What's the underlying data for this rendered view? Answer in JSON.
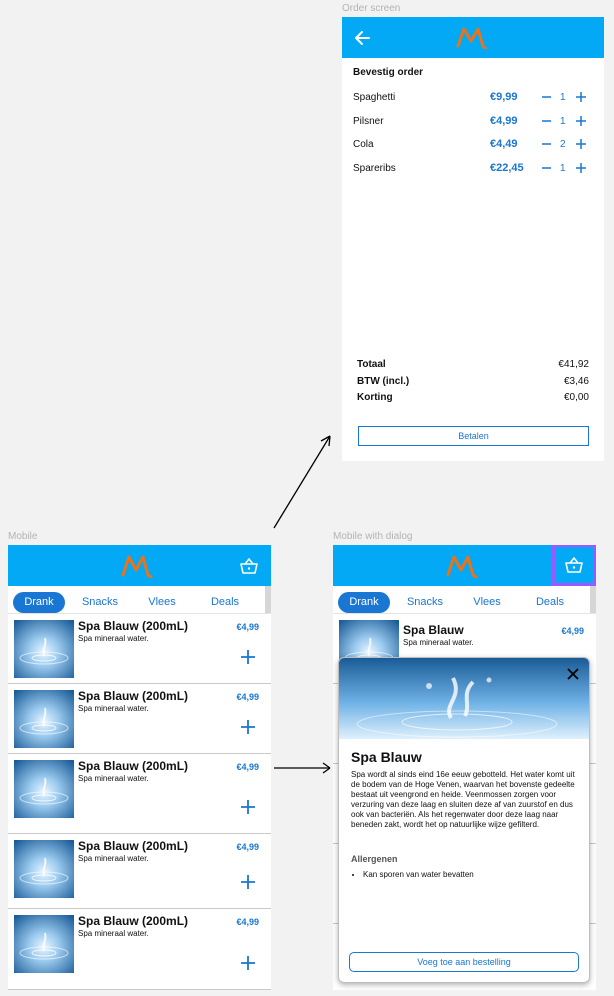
{
  "frames": {
    "order_label": "Order screen",
    "mobile_label": "Mobile",
    "dialog_label": "Mobile with dialog"
  },
  "order": {
    "title": "Bevestig order",
    "items": [
      {
        "name": "Spaghetti",
        "price": "€9,99",
        "qty": "1"
      },
      {
        "name": "Pilsner",
        "price": "€4,99",
        "qty": "1"
      },
      {
        "name": "Cola",
        "price": "€4,49",
        "qty": "2"
      },
      {
        "name": "Spareribs",
        "price": "€22,45",
        "qty": "1"
      }
    ],
    "summary": [
      {
        "label": "Totaal",
        "value": "€41,92"
      },
      {
        "label": "BTW (incl.)",
        "value": "€3,46"
      },
      {
        "label": "Korting",
        "value": "€0,00"
      }
    ],
    "pay_label": "Betalen"
  },
  "tabs": [
    "Drank",
    "Snacks",
    "Vlees",
    "Deals"
  ],
  "product": {
    "name": "Spa Blauw (200mL)",
    "desc": "Spa mineraal water.",
    "price": "€4,99"
  },
  "dialog_list_item": {
    "name": "Spa Blauw",
    "desc": "Spa mineraal water.",
    "price": "€4,99"
  },
  "dialog": {
    "title": "Spa Blauw",
    "body": "Spa wordt al sinds eind 16e eeuw gebotteld. Het water komt uit de bodem van de Hoge Venen, waarvan het bovenste gedeelte bestaat uit veengrond en heide. Veenmossen zorgen voor verzuring van deze laag en sluiten deze af van zuurstof en dus ook van bacteriën. Als het regenwater door deze laag naar beneden zakt, wordt het op natuurlijke wijze gefilterd.",
    "allergen_heading": "Allergenen",
    "allergens": [
      "Kan sporen van water bevatten"
    ],
    "add_label": "Voeg toe aan bestelling"
  },
  "colors": {
    "header": "#03a9f4",
    "accent": "#1976d2",
    "logo": "#e8731a",
    "highlight": "#9b59ff"
  },
  "icons": [
    "back-arrow-icon",
    "logo-icon",
    "basket-icon",
    "plus-icon",
    "minus-icon",
    "close-icon",
    "arrow-icon"
  ]
}
